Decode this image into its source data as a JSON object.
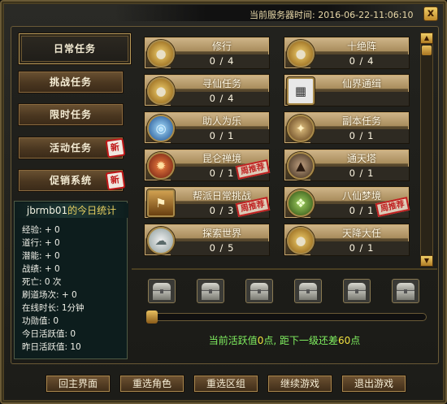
{
  "header": {
    "server_time_label": "当前服务器时间: 2016-06-22-11:06:10",
    "close_label": "x"
  },
  "nav": {
    "daily": "日常任务",
    "challenge": "挑战任务",
    "limited": "限时任务",
    "event": "活动任务",
    "promo": "促销系统",
    "new_badge": "新"
  },
  "stats": {
    "title_user": "jbrmb01",
    "title_suffix": "的今日统计",
    "rows": [
      "经验: + 0",
      "道行: + 0",
      "潜能: + 0",
      "战绩: + 0",
      "死亡: 0 次",
      "刷道场次: + 0",
      "在线时长: 1分钟",
      "功勋值: 0",
      "今日活跃值: 0",
      "昨日活跃值: 10"
    ]
  },
  "tasks": [
    {
      "name": "修行",
      "count": "0 / 4",
      "icon": "coin-bag-icon",
      "weekly": ""
    },
    {
      "name": "十绝阵",
      "count": "0 / 4",
      "icon": "coin-bag-icon",
      "weekly": ""
    },
    {
      "name": "寻仙任务",
      "count": "0 / 4",
      "icon": "coin-bag-icon",
      "weekly": ""
    },
    {
      "name": "仙界通缉",
      "count": "",
      "icon": "calendar-icon",
      "weekly": ""
    },
    {
      "name": "助人为乐",
      "count": "0 / 1",
      "icon": "vortex-icon",
      "weekly": ""
    },
    {
      "name": "副本任务",
      "count": "0 / 1",
      "icon": "warrior-icon",
      "weekly": ""
    },
    {
      "name": "昆仑禅境",
      "count": "0 / 1",
      "icon": "dragon-icon",
      "weekly": "周推荐"
    },
    {
      "name": "通天塔",
      "count": "0 / 1",
      "icon": "tower-icon",
      "weekly": ""
    },
    {
      "name": "帮派日常挑战",
      "count": "0 / 3",
      "icon": "banner-icon",
      "weekly": "周推荐"
    },
    {
      "name": "八仙梦境",
      "count": "0 / 1",
      "icon": "dream-icon",
      "weekly": "周推荐"
    },
    {
      "name": "探索世界",
      "count": "0 / 5",
      "icon": "cloud-icon",
      "weekly": ""
    },
    {
      "name": "天降大任",
      "count": "0 / 1",
      "icon": "coin-bag-icon",
      "weekly": ""
    }
  ],
  "activity": {
    "prefix": "当前活跃值",
    "current": "0",
    "middle": "点, 距下一级还差",
    "remaining": "60",
    "suffix": "点",
    "progress": 0
  },
  "buttons": {
    "main_menu": "回主界面",
    "reselect_char": "重选角色",
    "reselect_server": "重选区组",
    "continue": "继续游戏",
    "exit": "退出游戏"
  },
  "colors": {
    "accent_gold": "#e8c060",
    "activity_text": "#80f060",
    "activity_number": "#f0e040",
    "stamp_red": "#c02020"
  }
}
